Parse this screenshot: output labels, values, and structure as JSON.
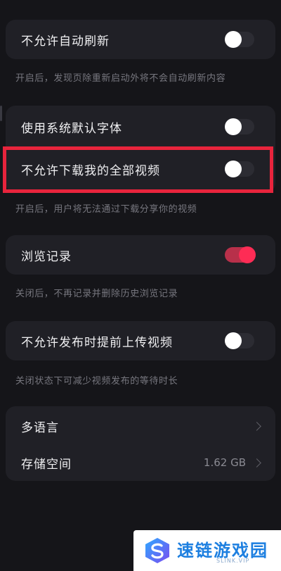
{
  "settings": {
    "no_auto_refresh": {
      "label": "不允许自动刷新",
      "description": "开启后，发现页除重新启动外将不会自动刷新内容",
      "enabled": false
    },
    "system_font": {
      "label": "使用系统默认字体",
      "enabled": false
    },
    "no_download_all_videos": {
      "label": "不允许下载我的全部视频",
      "description": "开启后，用户将无法通过下载分享你的视频",
      "enabled": false
    },
    "browse_history": {
      "label": "浏览记录",
      "description": "关闭后，不再记录并删除历史浏览记录",
      "enabled": true
    },
    "no_pre_upload": {
      "label": "不允许发布时提前上传视频",
      "description": "关闭状态下可减少视频发布的等待时长",
      "enabled": false
    },
    "language": {
      "label": "多语言"
    },
    "storage": {
      "label": "存储空间",
      "value": "1.62 GB"
    }
  },
  "colors": {
    "accent": "#fe2c55",
    "highlight_box": "#e8243c",
    "background": "#151519",
    "card": "#202026"
  },
  "watermark": {
    "title": "速链游戏园",
    "subtitle": "SLINK.VIP",
    "logo_icon": "dual-s-logo-icon"
  }
}
